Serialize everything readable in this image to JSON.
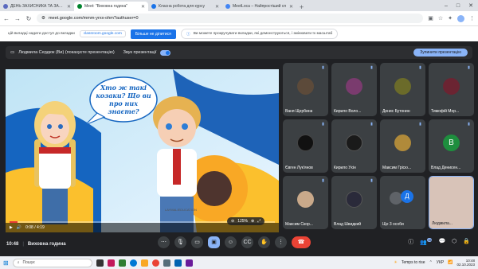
{
  "browser": {
    "tabs": [
      {
        "label": "ДЕНЬ ЗАХИСНИКА ТА ЗАХИСН",
        "active": false,
        "color": "#5b6abf"
      },
      {
        "label": "Meet: \"Виховна година\"",
        "active": true,
        "color": "#00832d"
      },
      {
        "label": "Класна робота для курсу",
        "active": false,
        "color": "#1a73e8"
      },
      {
        "label": "MeetLoca – Найпростіший сп",
        "active": false,
        "color": "#4285f4"
      }
    ],
    "new_tab": "+",
    "url": "meet.google.com/mmm-yrxx-ohm?authuser=0",
    "window": {
      "minimize": "–",
      "maximize": "□",
      "close": "✕"
    }
  },
  "banner": {
    "message": "цій вкладці надати доступ до вкладки",
    "tab_chip": "classroom.google.com",
    "share_button": "Більше не ділитися",
    "hint": "Ви можете прокручувати вкладки, які демонструються, і змінювати їх масштаб"
  },
  "presentation": {
    "presenter_label": "Людмила Сердюк (Ви) (показуєте презентацію)",
    "sound_label": "Звук презентації",
    "stop_button": "Зупинити презентацію",
    "slide_text": "Хто ж такі козаки? Що ви про них знаєте?",
    "video_time": "0:08 / 4:19",
    "progress": 0.03,
    "zoom": "125%"
  },
  "participants": [
    {
      "name": "Ваня Щербина",
      "kind": "photo",
      "color": "#5c4a3a"
    },
    {
      "name": "Кирило Воло...",
      "kind": "photo",
      "color": "#7a3b6e"
    },
    {
      "name": "Денис Бутонин",
      "kind": "photo",
      "color": "#6b6b2a"
    },
    {
      "name": "Тимофій Мор...",
      "kind": "photo",
      "color": "#6b2432"
    },
    {
      "name": "Євген Лук'янов",
      "kind": "photo",
      "color": "#111111"
    },
    {
      "name": "Кирило Ухін",
      "kind": "photo",
      "color": "#1a1a1a"
    },
    {
      "name": "Максим Грісю...",
      "kind": "photo",
      "color": "#b08a3a"
    },
    {
      "name": "Влад Денисен...",
      "kind": "letter",
      "letter": "В",
      "color": "#1e8e3e"
    },
    {
      "name": "Максим Скор...",
      "kind": "photo",
      "color": "#c9a98a"
    },
    {
      "name": "Влад Швидкий",
      "kind": "photo",
      "color": "#2a2a3a"
    },
    {
      "name": "Ще 3 особи",
      "kind": "more",
      "letter": "Д",
      "color": "#1a73e8"
    },
    {
      "name": "Людмила...",
      "kind": "self",
      "color": "#d8c3b8"
    }
  ],
  "meeting": {
    "time": "10:48",
    "title": "Виховна година",
    "people_count": "16"
  },
  "taskbar": {
    "search_placeholder": "Пошук",
    "weather": "Temps to rise",
    "lang": "УКР",
    "time": "10:48",
    "date": "02.10.2023"
  }
}
